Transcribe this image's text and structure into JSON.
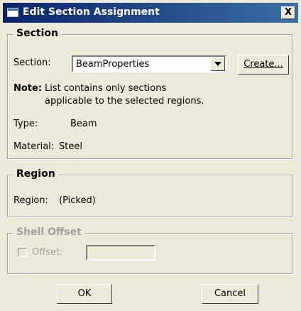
{
  "window": {
    "title": "Edit Section Assignment",
    "close_label": "X"
  },
  "section_group": {
    "title": "Section",
    "section_label": "Section:",
    "section_value": "BeamProperties",
    "create_button": "Create...",
    "note_label": "Note:",
    "note_line1": "List contains only sections",
    "note_line2": "applicable to the selected regions.",
    "type_label": "Type:",
    "type_value": "Beam",
    "material_label": "Material:",
    "material_value": "Steel"
  },
  "region_group": {
    "title": "Region",
    "region_label": "Region:",
    "region_value": "(Picked)"
  },
  "shell_offset_group": {
    "title": "Shell Offset",
    "offset_label": "Offset:",
    "offset_value": ""
  },
  "buttons": {
    "ok": "OK",
    "cancel": "Cancel"
  }
}
